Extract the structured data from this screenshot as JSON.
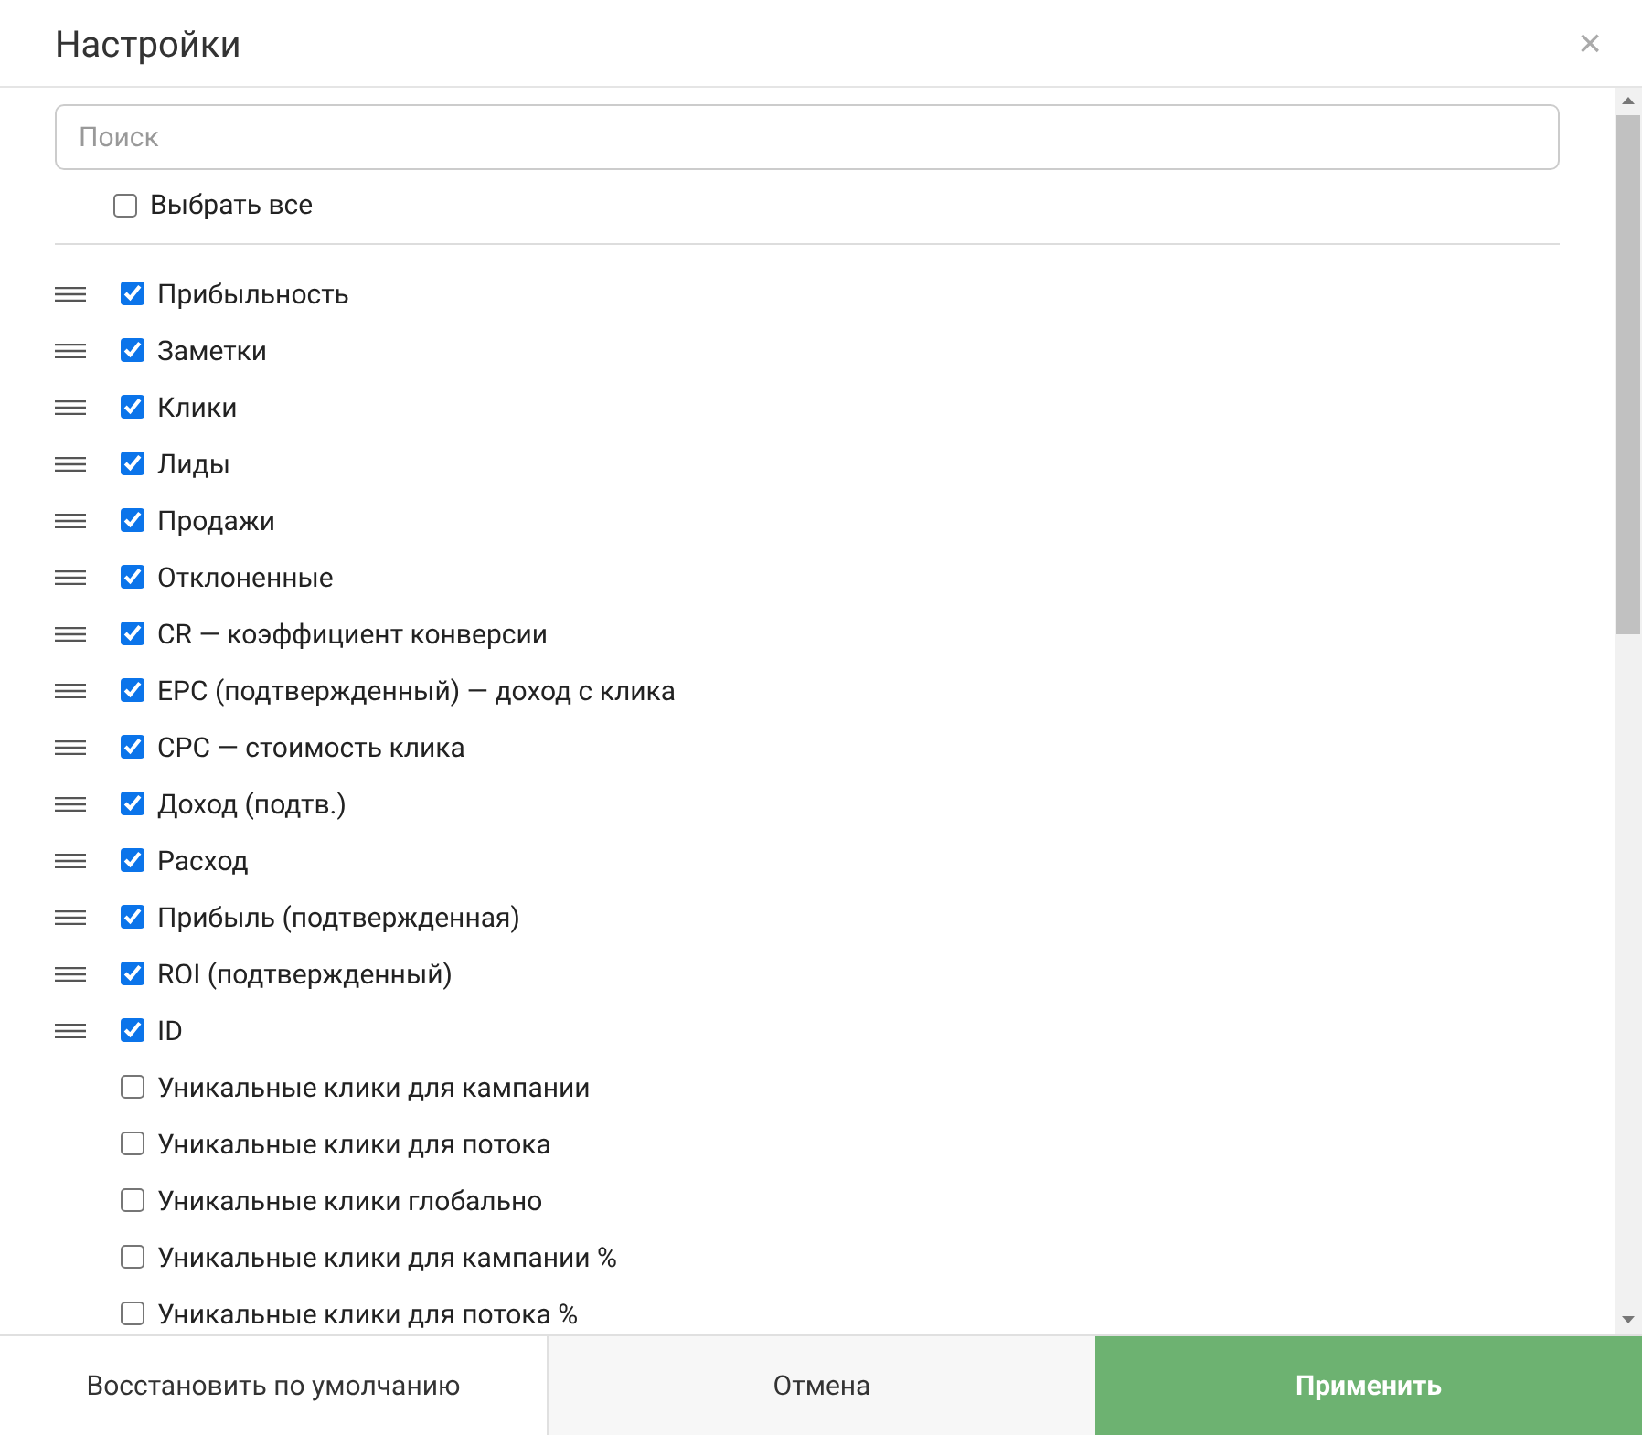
{
  "window": {
    "title": "Настройки",
    "close": "×"
  },
  "search": {
    "placeholder": "Поиск"
  },
  "select_all": {
    "label": "Выбрать все",
    "checked": false
  },
  "columns": [
    {
      "label": "Прибыльность",
      "checked": true
    },
    {
      "label": "Заметки",
      "checked": true
    },
    {
      "label": "Клики",
      "checked": true
    },
    {
      "label": "Лиды",
      "checked": true
    },
    {
      "label": "Продажи",
      "checked": true
    },
    {
      "label": "Отклоненные",
      "checked": true
    },
    {
      "label": "CR — коэффициент конверсии",
      "checked": true
    },
    {
      "label": "EPC (подтвержденный) — доход с клика",
      "checked": true
    },
    {
      "label": "CPC — стоимость клика",
      "checked": true
    },
    {
      "label": "Доход (подтв.)",
      "checked": true
    },
    {
      "label": "Расход",
      "checked": true
    },
    {
      "label": "Прибыль (подтвержденная)",
      "checked": true
    },
    {
      "label": "ROI (подтвержденный)",
      "checked": true
    },
    {
      "label": "ID",
      "checked": true
    },
    {
      "label": "Уникальные клики для кампании",
      "checked": false
    },
    {
      "label": "Уникальные клики для потока",
      "checked": false
    },
    {
      "label": "Уникальные клики глобально",
      "checked": false
    },
    {
      "label": "Уникальные клики для кампании %",
      "checked": false
    },
    {
      "label": "Уникальные клики для потока %",
      "checked": false
    }
  ],
  "buttons": [
    {
      "label": "Восстановить по умолчанию",
      "kind": "default"
    },
    {
      "label": "Отмена",
      "kind": "cancel"
    },
    {
      "label": "Применить",
      "kind": "primary"
    }
  ]
}
